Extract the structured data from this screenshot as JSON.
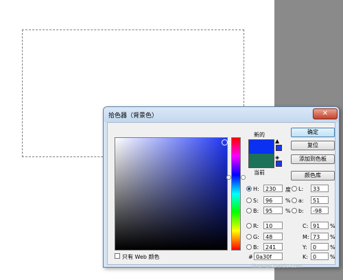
{
  "dialog": {
    "title": "拾色器（背景色）",
    "close_glyph": "✕"
  },
  "swatches": {
    "new_label": "新的",
    "current_label": "当前",
    "new_color": "#0a30f1",
    "current_color": "#1b7258"
  },
  "buttons": {
    "ok": "确定",
    "reset": "复位",
    "add_to_swatches": "添加到色板",
    "color_libraries": "颜色库"
  },
  "hsb": {
    "h_label": "H:",
    "h_value": "230",
    "h_unit": "度",
    "s_label": "S:",
    "s_value": "96",
    "s_unit": "%",
    "b_label": "B:",
    "b_value": "95",
    "b_unit": "%"
  },
  "lab": {
    "l_label": "L:",
    "l_value": "33",
    "a_label": "a:",
    "a_value": "51",
    "b_label": "b:",
    "b_value": "-98"
  },
  "rgb": {
    "r_label": "R:",
    "r_value": "10",
    "g_label": "G:",
    "g_value": "48",
    "b_label": "B:",
    "b_value": "241"
  },
  "cmyk": {
    "c_label": "C:",
    "c_value": "91",
    "c_unit": "%",
    "m_label": "M:",
    "m_value": "73",
    "m_unit": "%",
    "y_label": "Y:",
    "y_value": "0",
    "y_unit": "%",
    "k_label": "K:",
    "k_value": "0",
    "k_unit": "%"
  },
  "hex": {
    "label": "#",
    "value": "0a30f"
  },
  "web_only": {
    "label": "只有 Web 颜色",
    "checked": false
  },
  "watermark": "jingyan.baidu.com"
}
